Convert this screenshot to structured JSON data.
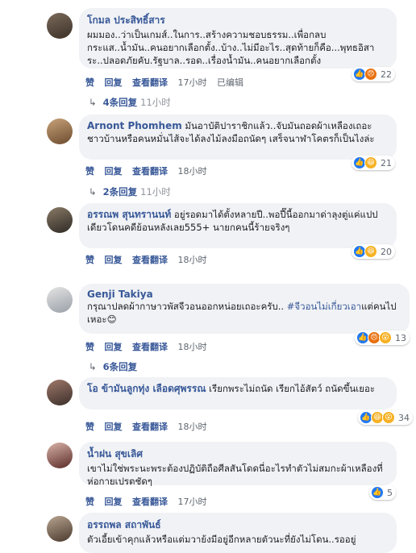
{
  "comments": [
    {
      "name": "โกมล ประสิทธิ์สาร",
      "text": "ผมมอง..ว่าเป็นเกมส์..ในการ..สร้างความชอบธรรม..เพื่อกลบกระแส..น้ำมัน..คนอยากเลือกตั้ง..บ้าง..ไม่มีอะไร..สุดท้ายก็คือ...พุทธอิสาระ..ปลอดภัยคับ.รัฐบาล..รอด..เรื่องน้ำมัน..คนอยากเลือกตั้ง",
      "actions": [
        "赞",
        "回复",
        "查看翻译",
        "17小时",
        "已编辑"
      ],
      "reaction_count": "22",
      "reaction_icons": [
        "like-icon",
        "angry-icon"
      ],
      "replies_label": "4条回复",
      "replies_time": "11小时"
    },
    {
      "name": "Arnont Phomhem",
      "text": "มันอาบัติปาราชิกแล้ว..จับมันถอดผ้าเหลืองเถอะชาวบ้านหรือคนหมั่นไส้จะได้ลงไม้ลงมือถนัดๆ เสร็จนาฬาโคตรก็เป็นไงล่ะ",
      "actions": [
        "赞",
        "回复",
        "查看翻译",
        "18小时"
      ],
      "reaction_count": "21",
      "reaction_icons": [
        "like-icon",
        "haha-icon"
      ],
      "replies_label": "2条回复",
      "replies_time": "11小时"
    },
    {
      "name": "อรรณพ สุนทรานนท์",
      "text": "อยู่รอดมาได้ตั้งหลายปี..พอปี๊นี้ออกมาด่าลุงตู่แค่แปปเดียวโดนคดีย้อนหลังเลย555+ นายกคนนี้ร้ายจริงๆ",
      "actions": [
        "赞",
        "回复",
        "查看翻译",
        "18小时"
      ],
      "reaction_count": "20",
      "reaction_icons": [
        "like-icon",
        "haha-icon"
      ]
    },
    {
      "name": "Genji Takiya",
      "text": "กรุณาปลดผ้ากาษาวพัสจีวอนออกหน่อยเถอะครับ.. #จีวอนไม่เกี่ยวเอาแต่คนไปเหอะ😊",
      "hashtag": "#จีวอนไม่เกี่ยวเอา",
      "actions": [
        "赞",
        "回复",
        "查看翻译",
        "18小时"
      ],
      "reaction_count": "13",
      "reaction_icons": [
        "like-icon",
        "angry-icon",
        "wow-icon"
      ],
      "replies_label": "6条回复"
    },
    {
      "name": "โอ ข้ามันลูกทุ่ง เลือดศุพรรณ",
      "text": "เรียกพระไม่ถนัด เรียกไอ้สัตว์ ถนัดขึ้นเยอะ",
      "actions": [
        "赞",
        "回复",
        "查看翻译",
        "18小时"
      ],
      "reaction_count": "34",
      "reaction_icons": [
        "like-icon",
        "haha-icon",
        "wow-icon"
      ]
    },
    {
      "name": "น้ำฝน สุขเลิศ",
      "text": "เขาไม่ใช่พระนะพระต้องปฏิบัติถือศีลสันโดดนี่อะไรทำตัวไม่สมกะผ้าเหลืองที่ห่อกายเปรตชัดๆ",
      "actions": [
        "赞",
        "回复",
        "查看翻译",
        "17小时"
      ],
      "reaction_count": "5",
      "reaction_icons": [
        "like-icon"
      ]
    },
    {
      "name": "อรรถพล สถาพันธ์",
      "text": "ตัวเอี้ยเข้าคุกแล้วหรือแต่มวาย้งมีอยู่อีกหลายตัวนะที่ยังไม่โดน..รออยู่"
    }
  ]
}
